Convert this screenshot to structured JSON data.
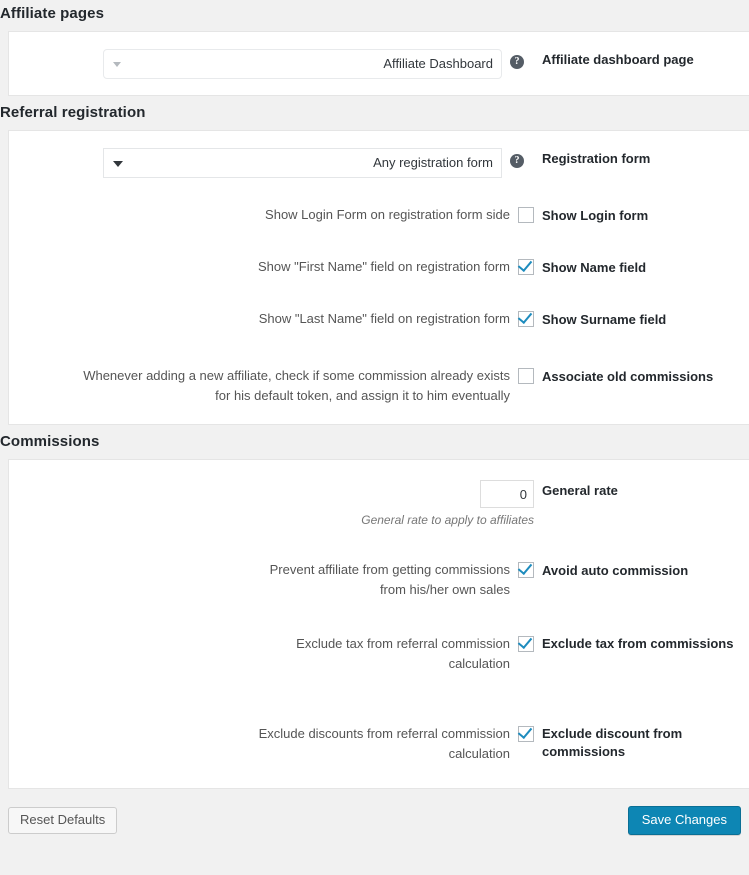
{
  "accent": {
    "primary_button_bg": "#0d86b4",
    "checkbox_check": "#1e8cbe",
    "heading_text": "#23282d",
    "page_bg": "#f1f1f1",
    "panel_bg": "#ffffff"
  },
  "sections": [
    {
      "heading": "Affiliate pages",
      "rows": [
        {
          "label": "Affiliate dashboard page",
          "type": "select",
          "value": "Affiliate Dashboard",
          "options": [
            "Affiliate Dashboard"
          ],
          "help": "?",
          "help_icon": "question-mark-circle-icon"
        }
      ]
    },
    {
      "heading": "Referral registration",
      "rows": [
        {
          "label": "Registration form",
          "type": "select",
          "value": "Any registration form",
          "options": [
            "Any registration form"
          ],
          "help": "?",
          "help_icon": "question-mark-circle-icon"
        },
        {
          "label": "Show Login form",
          "type": "checkbox",
          "checked": false,
          "text": "Show Login Form on registration form side"
        },
        {
          "label": "Show Name field",
          "type": "checkbox",
          "checked": true,
          "text": "Show \"First Name\" field on registration form"
        },
        {
          "label": "Show Surname field",
          "type": "checkbox",
          "checked": true,
          "text": "Show \"Last Name\" field on registration form"
        },
        {
          "label": "Associate old commissions",
          "type": "checkbox",
          "checked": false,
          "text": "Whenever adding a new affiliate, check if some commission already exists for his default token, and assign it to him eventually"
        }
      ]
    },
    {
      "heading": "Commissions",
      "rows": [
        {
          "label": "General rate",
          "type": "number",
          "value": "0",
          "description": "General rate to apply to affiliates"
        },
        {
          "label": "Avoid auto commission",
          "type": "checkbox",
          "checked": true,
          "text": "Prevent affiliate from getting commissions from his/her own sales"
        },
        {
          "label": "Exclude tax from commissions",
          "type": "checkbox",
          "checked": true,
          "text": "Exclude tax from referral commission calculation"
        },
        {
          "label": "Exclude discount from commissions",
          "type": "checkbox",
          "checked": true,
          "text": "Exclude discounts from referral commission calculation"
        }
      ]
    }
  ],
  "footer": {
    "save_label": "Save Changes",
    "reset_label": "Reset Defaults"
  }
}
